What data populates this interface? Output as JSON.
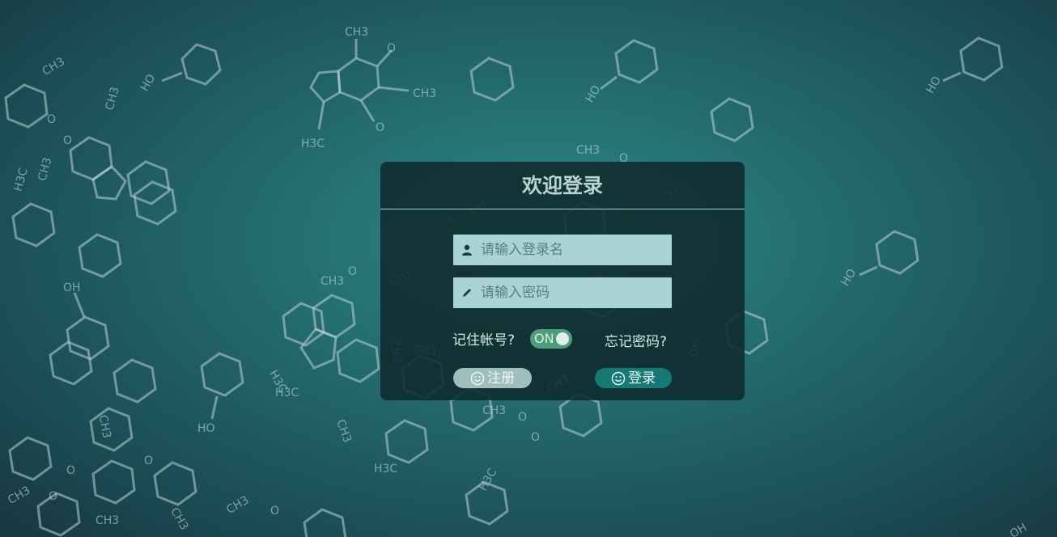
{
  "login": {
    "title": "欢迎登录",
    "username_placeholder": "请输入登录名",
    "password_placeholder": "请输入密码",
    "remember_label": "记住帐号?",
    "remember_toggle": "ON",
    "forgot_label": "忘记密码?",
    "register_label": "注册",
    "login_label": "登录"
  },
  "icons": {
    "user": "user-icon",
    "password": "pencil-icon",
    "register": "smile-icon",
    "login": "smile-icon"
  },
  "colors": {
    "panel_bg": "#0f2a2c",
    "field_bg": "#a9d4d3",
    "toggle_on": "#4d9e79",
    "login_button": "#167a74",
    "register_button": "#9fbfbd"
  }
}
